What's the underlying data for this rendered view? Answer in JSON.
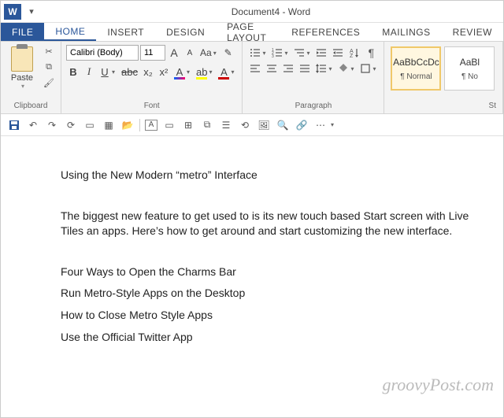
{
  "titlebar": {
    "logo": "W",
    "title": "Document4 - Word"
  },
  "tabs": {
    "file": "FILE",
    "home": "HOME",
    "insert": "INSERT",
    "design": "DESIGN",
    "page_layout": "PAGE LAYOUT",
    "references": "REFERENCES",
    "mailings": "MAILINGS",
    "review": "REVIEW"
  },
  "ribbon": {
    "clipboard": {
      "label": "Clipboard",
      "paste": "Paste"
    },
    "font": {
      "label": "Font",
      "name": "Calibri (Body)",
      "size": "11",
      "grow": "A",
      "shrink": "A",
      "case": "Aa",
      "clear": "✎",
      "bold": "B",
      "italic": "I",
      "under": "U",
      "strike": "abc",
      "sub": "x₂",
      "sup": "x²",
      "effects": "A",
      "hilite": "ab",
      "color": "A"
    },
    "paragraph": {
      "label": "Paragraph"
    },
    "styles": {
      "label": "St",
      "items": [
        {
          "preview": "AaBbCcDc",
          "name": "¶ Normal"
        },
        {
          "preview": "AaBl",
          "name": "¶ No"
        }
      ]
    }
  },
  "document": {
    "heading": "Using the New Modern “metro” Interface",
    "body": "The biggest new feature to get used to is its new touch based Start screen with Live Tiles an apps. Here’s how to get around and start customizing the new interface.",
    "list": [
      "Four Ways to Open the Charms Bar",
      "Run Metro-Style Apps on the Desktop",
      "How to Close Metro Style Apps",
      "Use the Official Twitter App"
    ]
  },
  "watermark": "groovyPost.com"
}
